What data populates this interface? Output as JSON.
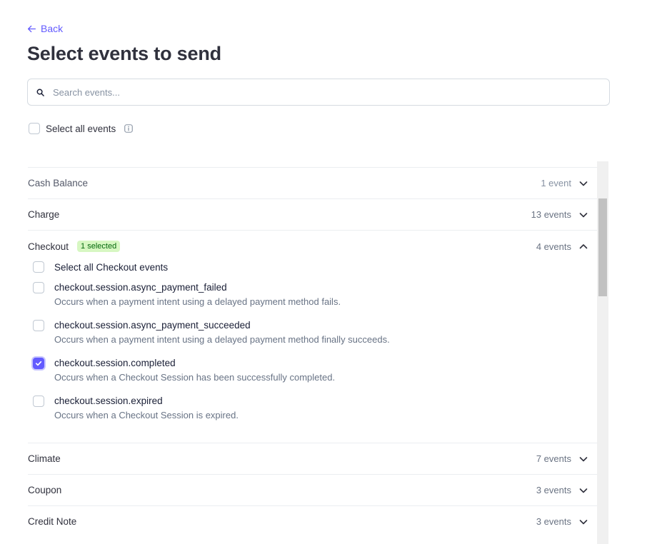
{
  "back": {
    "label": "Back"
  },
  "title": "Select events to send",
  "search": {
    "placeholder": "Search events...",
    "value": ""
  },
  "select_all": {
    "label": "Select all events",
    "checked": false
  },
  "categories": [
    {
      "name": "Cash Balance",
      "count": "1 event",
      "expanded": false
    },
    {
      "name": "Charge",
      "count": "13 events",
      "expanded": false
    },
    {
      "name": "Checkout",
      "badge": "1 selected",
      "count": "4 events",
      "expanded": true,
      "select_all_label": "Select all Checkout events",
      "events": [
        {
          "name": "checkout.session.async_payment_failed",
          "description": "Occurs when a payment intent using a delayed payment method fails.",
          "checked": false
        },
        {
          "name": "checkout.session.async_payment_succeeded",
          "description": "Occurs when a payment intent using a delayed payment method finally succeeds.",
          "checked": false
        },
        {
          "name": "checkout.session.completed",
          "description": "Occurs when a Checkout Session has been successfully completed.",
          "checked": true
        },
        {
          "name": "checkout.session.expired",
          "description": "Occurs when a Checkout Session is expired.",
          "checked": false
        }
      ]
    },
    {
      "name": "Climate",
      "count": "7 events",
      "expanded": false
    },
    {
      "name": "Coupon",
      "count": "3 events",
      "expanded": false
    },
    {
      "name": "Credit Note",
      "count": "3 events",
      "expanded": false
    }
  ],
  "colors": {
    "accent": "#635bff",
    "badge_bg": "#d7f7c2",
    "badge_text": "#05690d"
  }
}
